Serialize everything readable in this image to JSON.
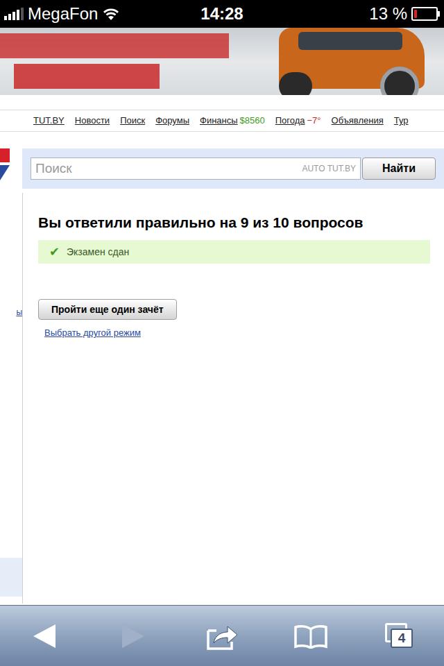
{
  "status_bar": {
    "carrier": "MegaFon",
    "time": "14:28",
    "battery": "13 %",
    "battery_level": 0.13,
    "signal_level": 0.8
  },
  "nav": {
    "items": [
      {
        "label": "TUT.BY"
      },
      {
        "label": "Новости"
      },
      {
        "label": "Поиск"
      },
      {
        "label": "Форумы"
      },
      {
        "label": "Финансы",
        "value": "$8560",
        "color": "#3f9a1e"
      },
      {
        "label": "Погода",
        "value": "−7°",
        "color": "#d2261a"
      },
      {
        "label": "Объявления"
      },
      {
        "label": "Тур"
      }
    ]
  },
  "search": {
    "placeholder": "Поиск",
    "scope": "AUTO TUT.BY",
    "button": "Найти"
  },
  "sidebar": {
    "link_fragment": "ы"
  },
  "result": {
    "heading": "Вы ответили правильно на 9 из 10 вопросов",
    "status_icon": "✔",
    "status": "Экзамен сдан",
    "passed": true
  },
  "actions": {
    "button": "Пройти еще один зачёт",
    "link": "Выбрать другой режим"
  },
  "toolbar": {
    "back_enabled": true,
    "forward_enabled": false,
    "tabs_count": "4"
  }
}
